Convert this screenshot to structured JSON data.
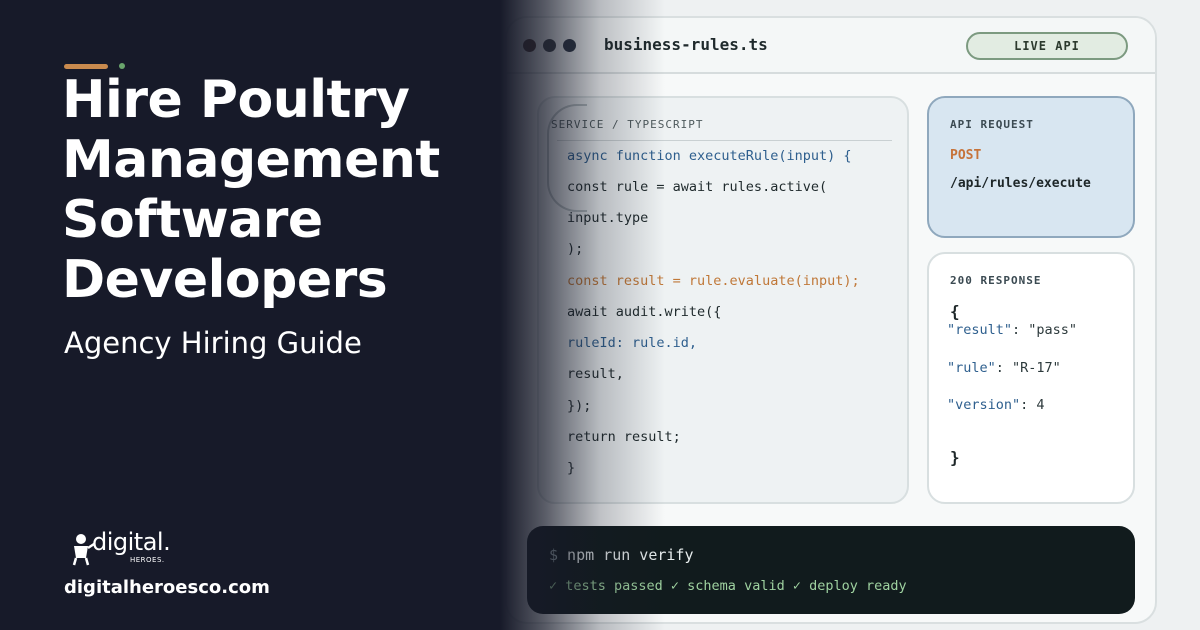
{
  "editor": {
    "filename": "business-rules.ts",
    "badge": "LIVE API",
    "code_label": "SERVICE / TYPESCRIPT",
    "code_lines": [
      "async function executeRule(input) {",
      "const rule = await rules.active(",
      "input.type",
      ");",
      "const result = rule.evaluate(input);",
      "await audit.write({",
      "ruleId: rule.id,",
      "result,",
      "});",
      "return result;",
      "}"
    ]
  },
  "api_request": {
    "label": "API REQUEST",
    "method": "POST",
    "path": "/api/rules/execute"
  },
  "response": {
    "label": "200 RESPONSE",
    "open_brace": "{",
    "close_brace": "}",
    "fields": [
      {
        "key": "\"result\"",
        "value": ": \"pass\""
      },
      {
        "key": "\"rule\"",
        "value": ": \"R-17\""
      },
      {
        "key": "\"version\"",
        "value": ": 4"
      }
    ]
  },
  "terminal": {
    "prompt": "$",
    "command": " npm run verify",
    "output": "✓ tests passed ✓ schema valid ✓ deploy ready"
  },
  "hero": {
    "headline_lines": [
      "Hire Poultry",
      "Management",
      "Software",
      "Developers"
    ],
    "subhead": "Agency Hiring Guide",
    "logo_word": "digital.",
    "logo_sub": "HEROES.",
    "url": "digitalheroesco.com"
  },
  "colors": {
    "dark_bg": "#171a29",
    "accent_orange": "#c98a4e",
    "accent_green": "#6aa56c",
    "terminal_bg": "#111b1d",
    "api_card_bg": "#d8e6f1"
  }
}
